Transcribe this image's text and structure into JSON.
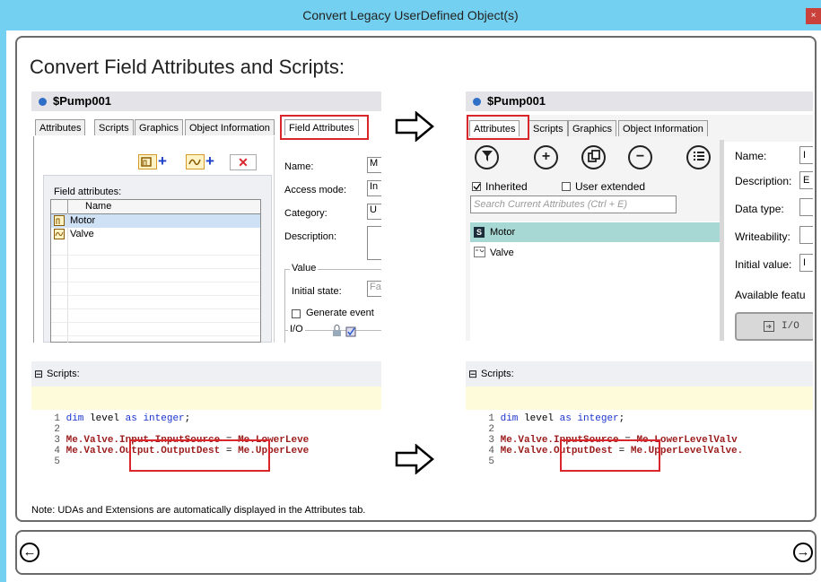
{
  "window": {
    "title": "Convert Legacy UserDefined Object(s)",
    "close_glyph": "×"
  },
  "heading": "Convert Field Attributes and Scripts:",
  "left_object": {
    "name": "$Pump001",
    "tabs": [
      "Attributes",
      "Scripts",
      "Graphics",
      "Object Information",
      "Field Attributes"
    ],
    "field_attributes_label": "Field attributes:",
    "grid_header": "Name",
    "rows": [
      "Motor",
      "Valve"
    ],
    "form": {
      "name": "Name:",
      "access_mode": "Access mode:",
      "category": "Category:",
      "description": "Description:",
      "value_group": "Value",
      "initial_state": "Initial state:",
      "generate_events": "Generate event",
      "io_group": "I/O",
      "name_value": "M",
      "access_value": "In",
      "category_value": "U",
      "initial_state_value": "Fa"
    }
  },
  "right_object": {
    "name": "$Pump001",
    "tabs": [
      "Attributes",
      "Scripts",
      "Graphics",
      "Object Information"
    ],
    "inherited": "Inherited",
    "user_extended": "User extended",
    "search_placeholder": "Search Current Attributes (Ctrl + E)",
    "rows": [
      "Motor",
      "Valve"
    ],
    "form": {
      "name": "Name:",
      "description": "Description:",
      "data_type": "Data type:",
      "writeability": "Writeability:",
      "initial_value": "Initial value:",
      "available_features": "Available featu",
      "io_button": "I/O",
      "name_value": "I",
      "description_value": "E",
      "initial_value_value": "I"
    }
  },
  "scripts": {
    "label": "Scripts:",
    "collapse_glyph": "⊟",
    "left_lines": [
      {
        "n": "1",
        "parts": [
          [
            "kw",
            "dim"
          ],
          [
            "plain",
            " level "
          ],
          [
            "kw",
            "as"
          ],
          [
            "plain",
            " "
          ],
          [
            "kw",
            "integer"
          ],
          [
            "plain",
            ";"
          ]
        ]
      },
      {
        "n": "2",
        "parts": []
      },
      {
        "n": "3",
        "parts": [
          [
            "me",
            "Me.Valve"
          ],
          [
            "me",
            ".Input.InputSource"
          ],
          [
            "plain",
            " = "
          ],
          [
            "me",
            "Me.LowerLeve"
          ]
        ]
      },
      {
        "n": "4",
        "parts": [
          [
            "me",
            "Me.Valve"
          ],
          [
            "me",
            ".Output.OutputDest"
          ],
          [
            "plain",
            " = "
          ],
          [
            "me",
            "Me.UpperLeve"
          ]
        ]
      },
      {
        "n": "5",
        "parts": []
      }
    ],
    "right_lines": [
      {
        "n": "1",
        "parts": [
          [
            "kw",
            "dim"
          ],
          [
            "plain",
            " level "
          ],
          [
            "kw",
            "as"
          ],
          [
            "plain",
            " "
          ],
          [
            "kw",
            "integer"
          ],
          [
            "plain",
            ";"
          ]
        ]
      },
      {
        "n": "2",
        "parts": []
      },
      {
        "n": "3",
        "parts": [
          [
            "me",
            "Me.Valve"
          ],
          [
            "me",
            ".InputSource "
          ],
          [
            "plain",
            "= "
          ],
          [
            "me",
            "Me.LowerLevelValv"
          ]
        ]
      },
      {
        "n": "4",
        "parts": [
          [
            "me",
            "Me.Valve"
          ],
          [
            "me",
            ".OutputDest "
          ],
          [
            "plain",
            "= "
          ],
          [
            "me",
            "Me.UpperLevelValve."
          ]
        ]
      },
      {
        "n": "5",
        "parts": []
      }
    ]
  },
  "note": "Note: UDAs and Extensions are automatically displayed in the Attributes tab.",
  "nav": {
    "back_glyph": "←",
    "next_glyph": "→"
  },
  "colors": {
    "titlebar": "#73d0f1",
    "highlight": "#d9262b",
    "keyword": "#1a33cc",
    "member": "#9b1b1b"
  }
}
